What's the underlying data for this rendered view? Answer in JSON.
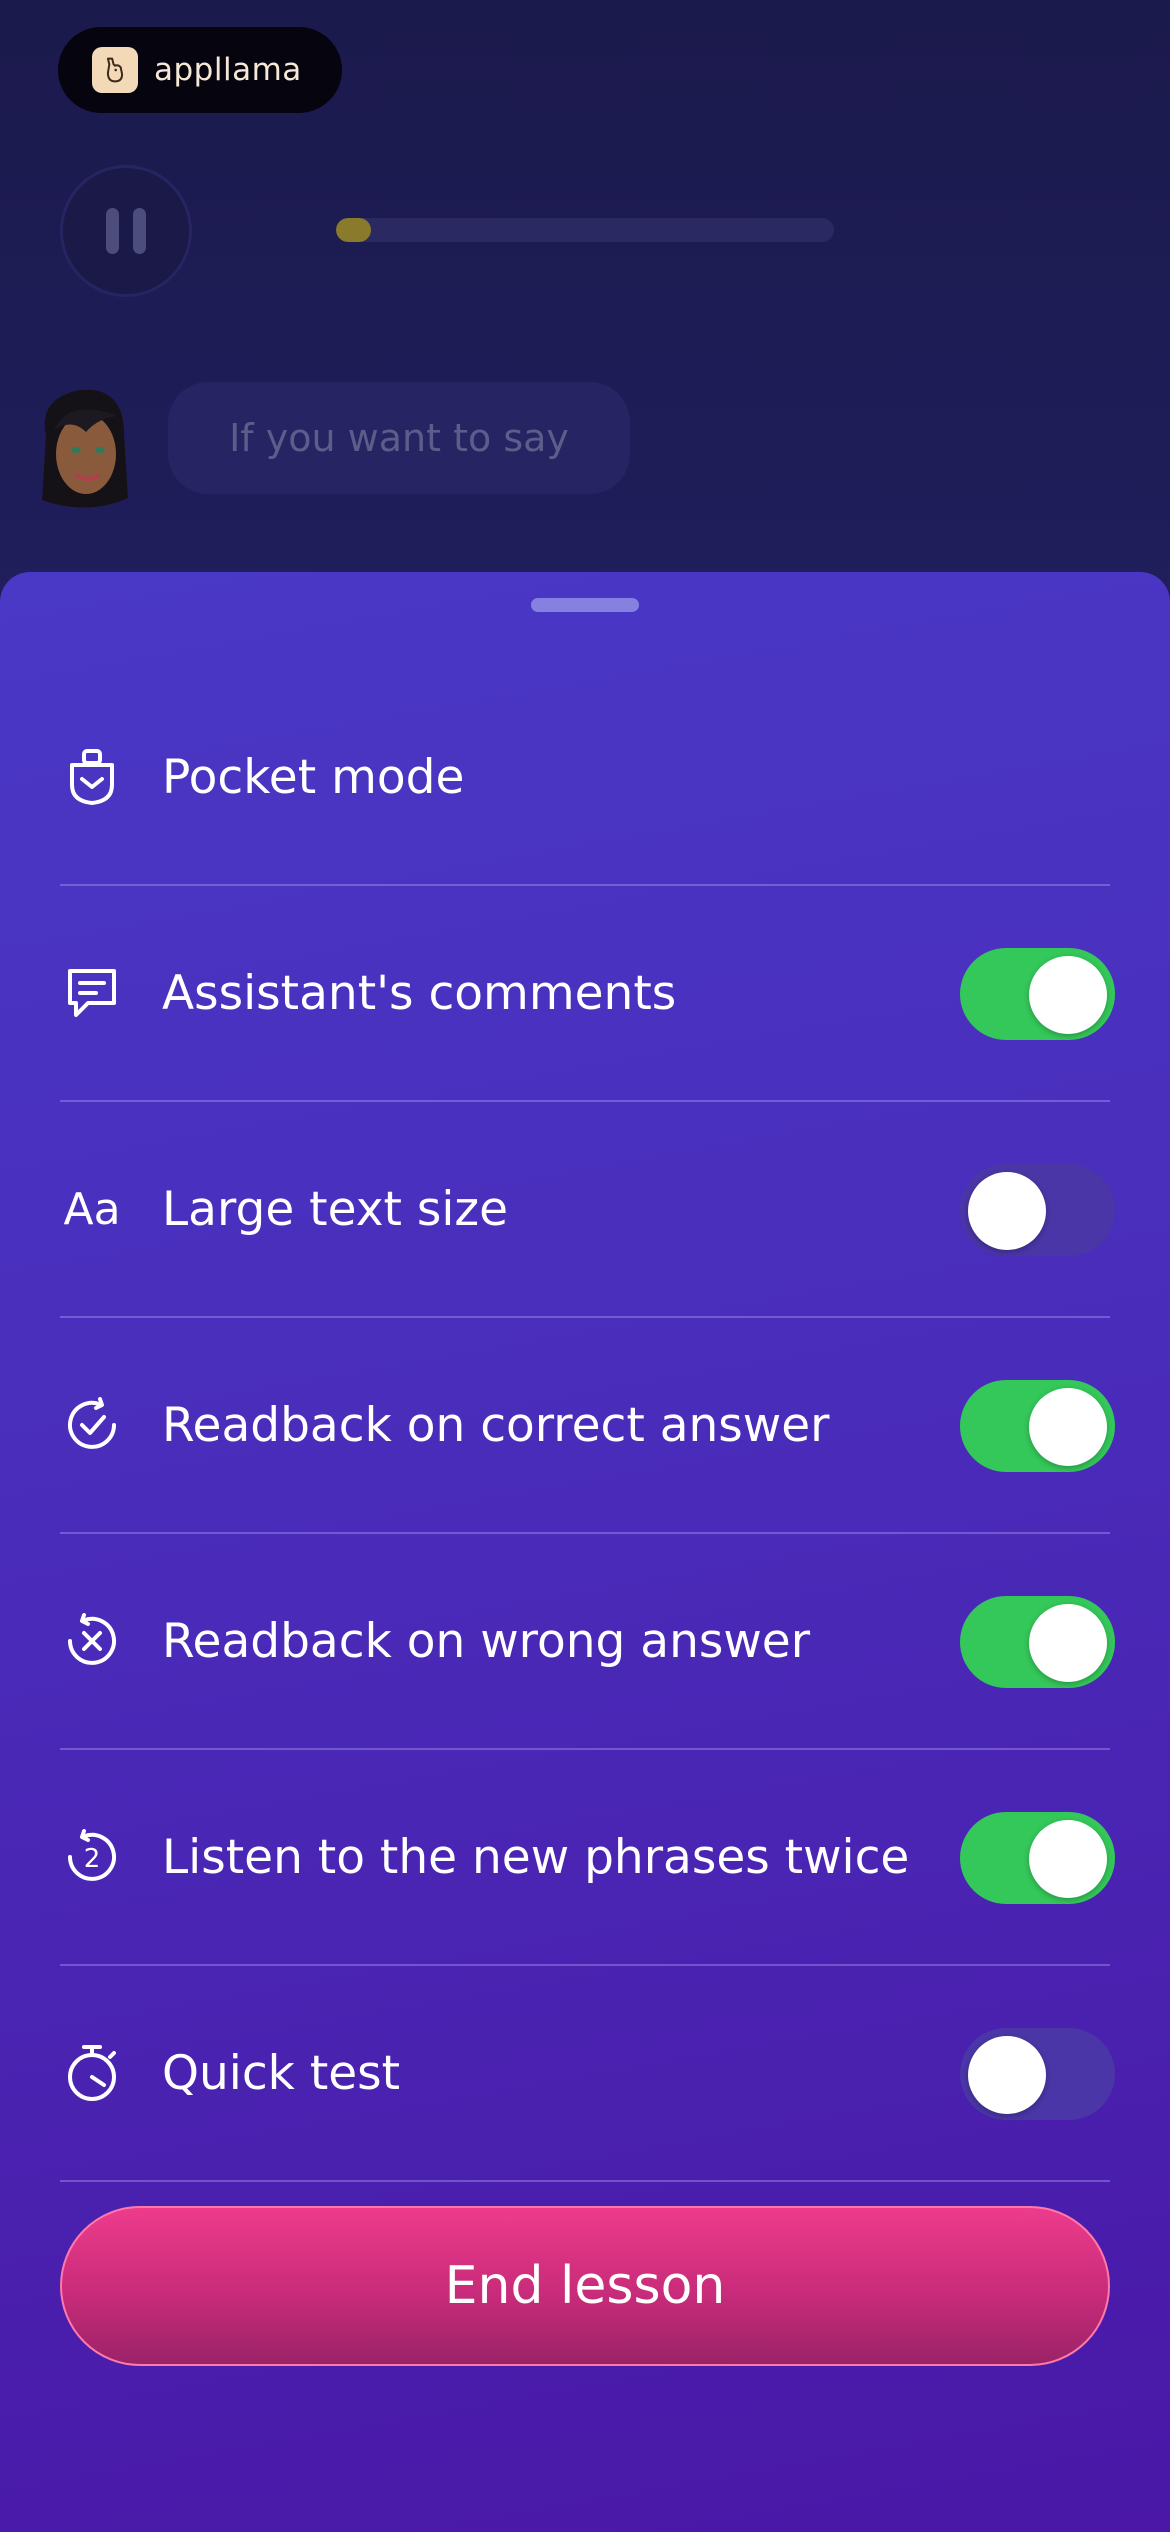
{
  "brand": {
    "name": "appllama",
    "logo_icon": "llama-logo-icon"
  },
  "lesson": {
    "progress_fraction": 0.07,
    "pause_icon": "pause-icon",
    "bubble_text": "If you want to say"
  },
  "settings": {
    "items": [
      {
        "id": "pocket-mode",
        "icon": "pocket-icon",
        "label": "Pocket mode",
        "has_toggle": false
      },
      {
        "id": "assistant-comments",
        "icon": "chat-bubble-icon",
        "label": "Assistant's comments",
        "has_toggle": true,
        "on": true
      },
      {
        "id": "large-text-size",
        "icon": "text-size-icon",
        "icon_text": "Aa",
        "label": "Large text size",
        "has_toggle": true,
        "on": false
      },
      {
        "id": "readback-correct",
        "icon": "check-circle-icon",
        "label": "Readback on correct answer",
        "has_toggle": true,
        "on": true
      },
      {
        "id": "readback-wrong",
        "icon": "x-circle-icon",
        "label": "Readback on wrong answer",
        "has_toggle": true,
        "on": true
      },
      {
        "id": "listen-twice",
        "icon": "repeat-two-icon",
        "icon_text": "2",
        "label": "Listen to the new phrases twice",
        "has_toggle": true,
        "on": true
      },
      {
        "id": "quick-test",
        "icon": "stopwatch-icon",
        "label": "Quick test",
        "has_toggle": true,
        "on": false
      }
    ]
  },
  "end_button": {
    "label": "End lesson"
  },
  "colors": {
    "toggle_on": "#34c759",
    "toggle_off": "#4a36a6",
    "end_button": "#e0357f",
    "sheet_top": "#4a38c6",
    "sheet_bottom": "#4a17a6"
  }
}
